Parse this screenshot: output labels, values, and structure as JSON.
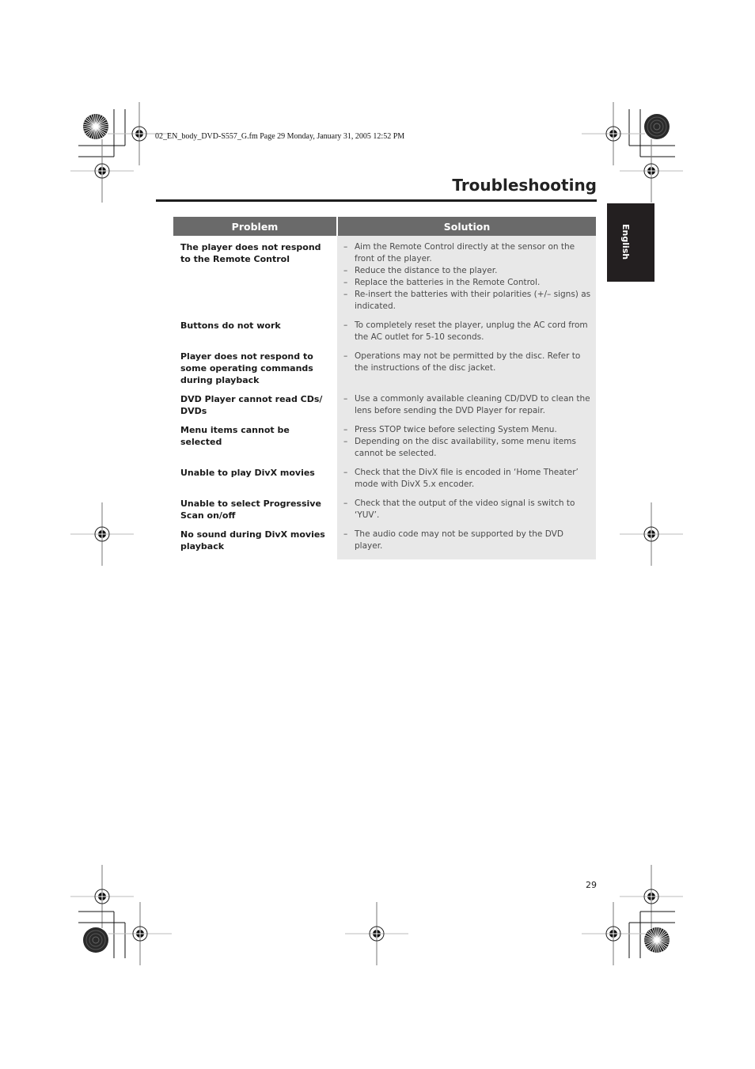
{
  "file_header": "02_EN_body_DVD-S557_G.fm  Page 29  Monday, January 31, 2005  12:52 PM",
  "page_title": "Troubleshooting",
  "language_tab": "English",
  "table": {
    "headers": {
      "problem": "Problem",
      "solution": "Solution"
    },
    "rows": [
      {
        "problem": "The player does not respond to the Remote Control",
        "solutions": [
          "Aim the Remote Control directly at the sensor on the front of the player.",
          "Reduce the distance to the player.",
          "Replace the batteries in the Remote Control.",
          "Re-insert the batteries with their polarities (+/– signs) as indicated."
        ]
      },
      {
        "problem": "Buttons do not work",
        "solutions": [
          "To completely reset the player, unplug the AC cord from the AC outlet for 5-10 seconds."
        ]
      },
      {
        "problem": "Player does not respond to some operating commands during playback",
        "solutions": [
          "Operations may not be permitted by the disc. Refer to the instructions of the disc jacket."
        ]
      },
      {
        "problem": "DVD Player cannot read CDs/ DVDs",
        "solutions": [
          "Use a commonly available cleaning CD/DVD to clean the lens before sending the DVD Player for repair."
        ]
      },
      {
        "problem": "Menu items cannot be selected",
        "solutions": [
          "Press STOP twice before selecting System Menu.",
          "Depending on the disc availability, some menu items cannot be selected."
        ]
      },
      {
        "problem": "Unable to play DivX movies",
        "solutions": [
          "Check that the DivX file is encoded in ‘Home Theater’ mode with DivX 5.x encoder."
        ]
      },
      {
        "problem": "Unable to select Progressive Scan on/off",
        "solutions": [
          "Check that the output of the video signal is switch to ‘YUV’."
        ]
      },
      {
        "problem": "No sound during DivX movies playback",
        "solutions": [
          "The audio code may not be supported by the DVD player."
        ]
      }
    ]
  },
  "page_number": "29",
  "colors": {
    "table_header_bg": "#6a6a6a",
    "solution_bg": "#e8e8e8",
    "language_tab_bg": "#231f20",
    "title_rule": "#1e1e1e"
  }
}
